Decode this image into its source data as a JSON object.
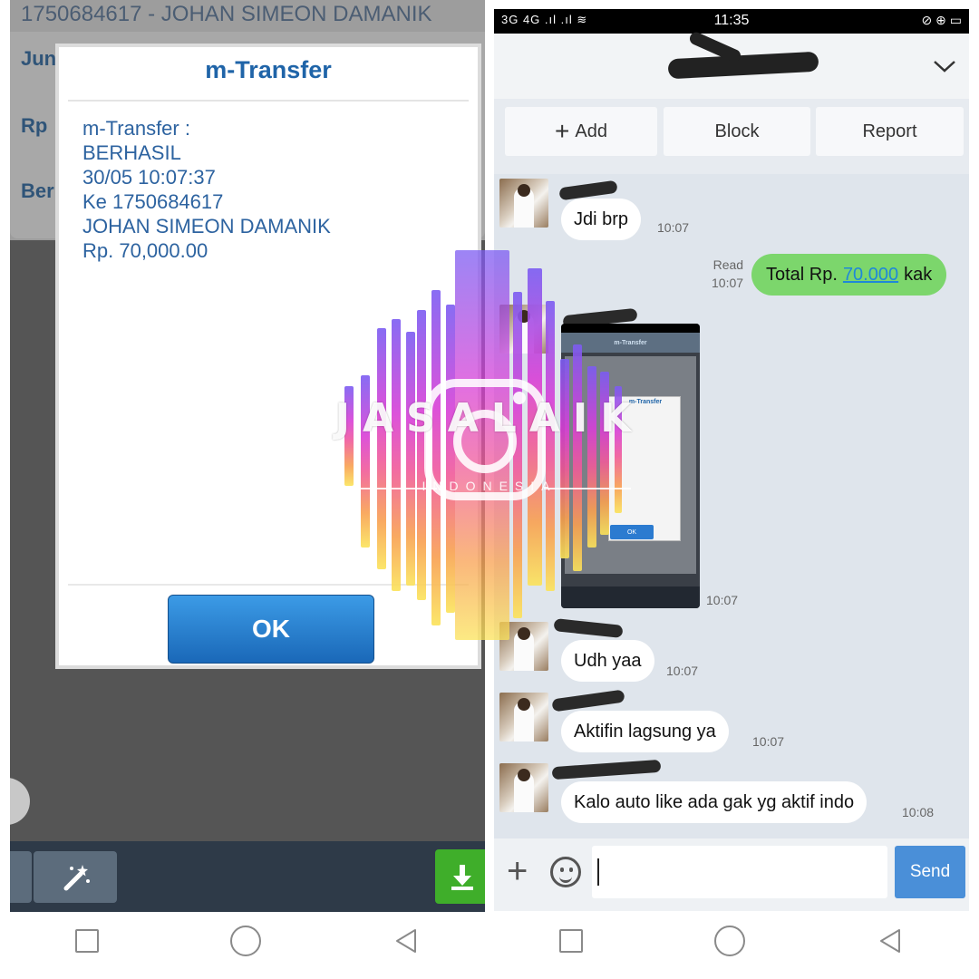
{
  "left_panel": {
    "background_account": "1750684617 - JOHAN SIMEON DAMANIK",
    "background_labels": [
      "Jun",
      "Rp",
      "Ber"
    ],
    "dialog": {
      "title": "m-Transfer",
      "lines": [
        "m-Transfer :",
        "BERHASIL",
        "30/05 10:07:37",
        "Ke 1750684617",
        "JOHAN SIMEON DAMANIK",
        "Rp. 70,000.00"
      ],
      "ok_label": "OK"
    },
    "toolbar_icons": [
      "magic-wand-icon",
      "download-icon"
    ],
    "colors": {
      "title": "#1f64a8",
      "ok_button": "#1a68b8",
      "download_button": "#3fae2a"
    }
  },
  "right_panel": {
    "status_bar": {
      "signal": "3G 4G .ıl .ıl ≋",
      "time": "11:35",
      "system": "⊘ ⊕ ▭"
    },
    "header": {
      "title_redacted": true,
      "chevron": "chevron-down-icon"
    },
    "actions": [
      {
        "label": "Add",
        "icon": "plus-icon"
      },
      {
        "label": "Block"
      },
      {
        "label": "Report"
      }
    ],
    "messages": [
      {
        "side": "in",
        "text": "Jdi brp",
        "time": "10:07"
      },
      {
        "side": "out",
        "prefix": "Total Rp.",
        "link": "70.000",
        "suffix": "kak",
        "status": "Read",
        "time": "10:07"
      },
      {
        "side": "in",
        "type": "image",
        "image_title": "m-Transfer",
        "image_dialog_title": "m-Transfer",
        "image_ok": "OK",
        "time": "10:07"
      },
      {
        "side": "in",
        "text": "Udh yaa",
        "time": "10:07"
      },
      {
        "side": "in",
        "text": "Aktifin lagsung ya",
        "time": "10:07"
      },
      {
        "side": "in",
        "text": "Kalo auto like ada gak yg aktif indo",
        "time": "10:08"
      }
    ],
    "composer": {
      "placeholder": "",
      "send_label": "Send"
    },
    "colors": {
      "outgoing_bubble": "#7cd66c",
      "send_button": "#4a8fd8",
      "link": "#1f88d8"
    }
  },
  "watermark": {
    "text": "JASALAIK",
    "subtext": "INDONESIA"
  }
}
